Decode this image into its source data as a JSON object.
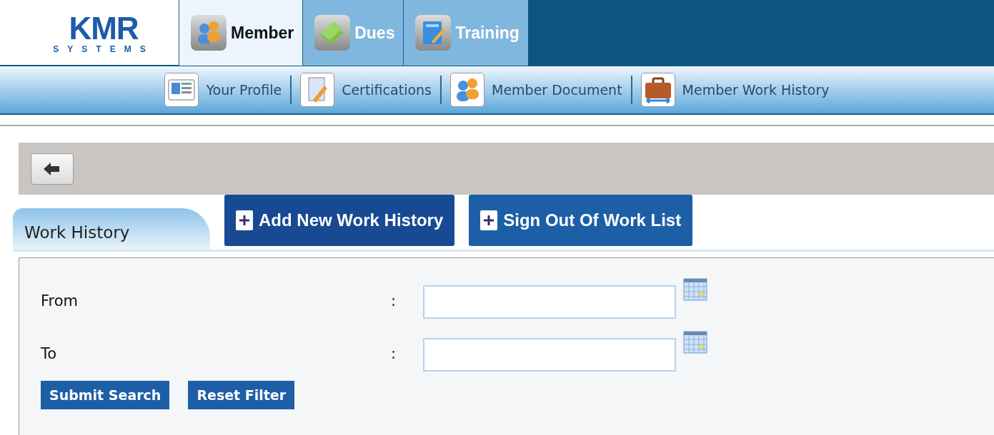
{
  "logo": {
    "name": "KMR",
    "tagline": "SYSTEMS"
  },
  "main_tabs": [
    {
      "label": "Member",
      "selected": true,
      "kind": "people"
    },
    {
      "label": "Dues",
      "selected": false,
      "kind": "money"
    },
    {
      "label": "Training",
      "selected": false,
      "kind": "notebook"
    }
  ],
  "sub_nav": [
    {
      "label": "Your Profile",
      "kind": "profile"
    },
    {
      "label": "Certifications",
      "kind": "document"
    },
    {
      "label": "Member Document",
      "kind": "people"
    },
    {
      "label": "Member Work History",
      "kind": "briefcase"
    }
  ],
  "panel_tabs": [
    {
      "label": "Work History",
      "selected": true
    }
  ],
  "actions": [
    {
      "label": "Add New Work History",
      "color": "#174a92"
    },
    {
      "label": "Sign Out Of Work List",
      "color": "#1d5fa6"
    }
  ],
  "filters": [
    {
      "label": "From",
      "separator": ":"
    },
    {
      "label": "To",
      "separator": ":"
    }
  ],
  "buttons": [
    "Submit Search",
    "Reset Filter"
  ]
}
